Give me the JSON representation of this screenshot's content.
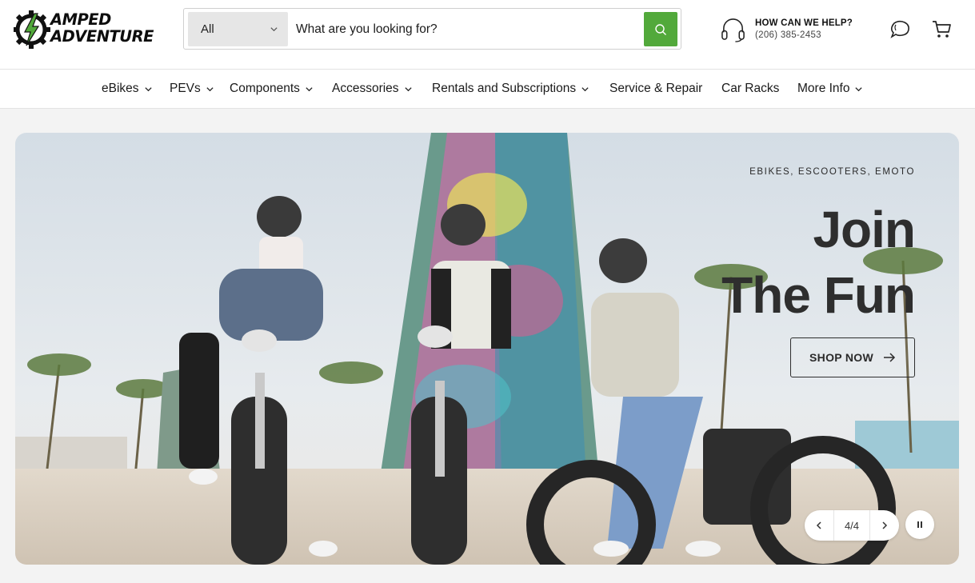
{
  "brand": {
    "logo_line1": "AMPED",
    "logo_line2": "ADVENTURE",
    "accent_color": "#52a93b"
  },
  "search": {
    "category": "All",
    "placeholder": "What are you looking for?",
    "button_icon": "search-icon"
  },
  "help": {
    "title": "HOW CAN WE HELP?",
    "phone": "(206) 385-2453",
    "icon": "headset-icon"
  },
  "header_icons": [
    "chat-icon",
    "cart-icon"
  ],
  "nav": {
    "items": [
      {
        "label": "eBikes",
        "has_dropdown": true
      },
      {
        "label": "PEVs",
        "has_dropdown": true
      },
      {
        "label": "Components",
        "has_dropdown": true
      },
      {
        "label": "Accessories",
        "has_dropdown": true
      },
      {
        "label": "Rentals and Subscriptions",
        "has_dropdown": true
      },
      {
        "label": "Service & Repair",
        "has_dropdown": false
      },
      {
        "label": "Car Racks",
        "has_dropdown": false
      },
      {
        "label": "More Info",
        "has_dropdown": true
      }
    ]
  },
  "hero": {
    "eyebrow": "EBIKES, ESCOOTERS, EMOTO",
    "title_line1": "Join",
    "title_line2": "The Fun",
    "cta": "SHOP NOW",
    "slide_counter": "4/4"
  }
}
